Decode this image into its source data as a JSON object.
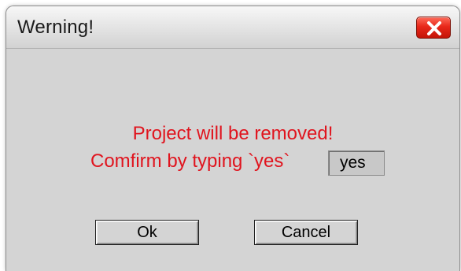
{
  "dialog": {
    "title": "Werning!",
    "close_icon": "close-icon",
    "accent_color": "#e0141e",
    "close_color": "#e8281a"
  },
  "message": {
    "line1": "Project will be removed!",
    "line2": "Comfirm by typing `yes`"
  },
  "confirm_input": {
    "value": "yes"
  },
  "buttons": {
    "ok_label": "Ok",
    "cancel_label": "Cancel"
  }
}
